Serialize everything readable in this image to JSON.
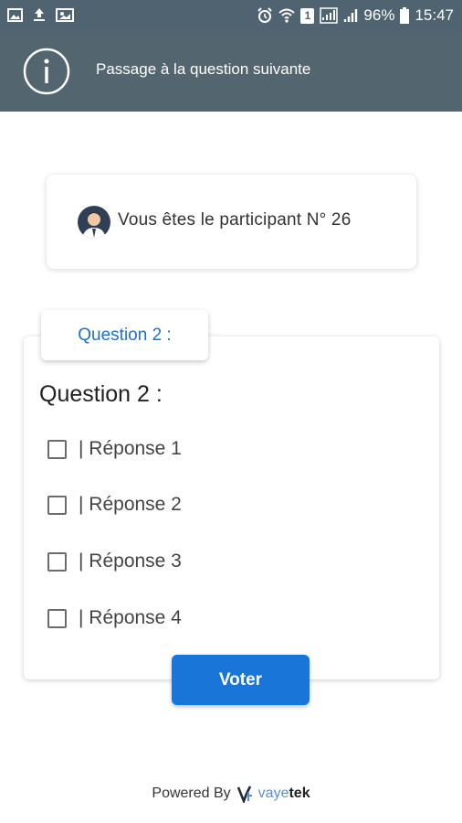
{
  "status_bar": {
    "battery": "96%",
    "time": "15:47",
    "sim_number": "1"
  },
  "notification": {
    "icon": "info-icon",
    "message": "Passage à la question suivante"
  },
  "participant": {
    "text": "Vous êtes le participant N° 26"
  },
  "question": {
    "tab_label": "Question 2 :",
    "title": "Question 2 :",
    "answers": [
      {
        "label": "| Réponse 1",
        "checked": false
      },
      {
        "label": "| Réponse 2",
        "checked": false
      },
      {
        "label": "| Réponse 3",
        "checked": false
      },
      {
        "label": "| Réponse 4",
        "checked": false
      }
    ],
    "vote_label": "Voter"
  },
  "footer": {
    "powered_by": "Powered By",
    "brand_light": "vaye",
    "brand_bold": "tek"
  },
  "colors": {
    "header": "#53666f",
    "accent": "#1976d8"
  }
}
